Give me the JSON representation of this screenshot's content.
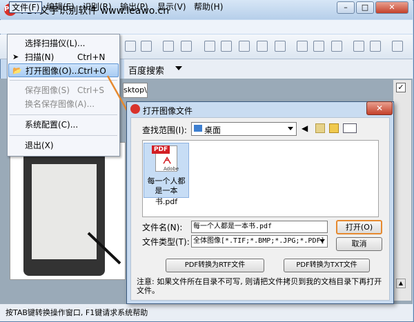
{
  "app": {
    "title": "PDF文字识别软件 www.leawo.cn",
    "icon_text": "PDF"
  },
  "window_controls": {
    "minimize": "–",
    "maximize": "□",
    "close": "✕"
  },
  "menubar": [
    "文件(F)",
    "编辑(E)",
    "识别(R)",
    "输出(P)",
    "显示(V)",
    "帮助(H)"
  ],
  "file_menu": {
    "items": [
      {
        "label": "选择扫描仪(L)...",
        "shortcut": "",
        "disabled": false
      },
      {
        "label": "扫描(N)",
        "shortcut": "Ctrl+N",
        "disabled": false
      },
      {
        "label": "打开图像(O)...",
        "shortcut": "Ctrl+O",
        "disabled": false,
        "highlighted": true
      },
      {
        "label": "保存图像(S)",
        "shortcut": "Ctrl+S",
        "disabled": true
      },
      {
        "label": "换名保存图像(A)...",
        "shortcut": "",
        "disabled": true
      },
      {
        "label": "系统配置(C)...",
        "shortcut": "",
        "disabled": false
      },
      {
        "label": "退出(X)",
        "shortcut": "",
        "disabled": false
      }
    ]
  },
  "search": {
    "label": "百度搜索"
  },
  "desktop_strip": "sktop\\",
  "dialog": {
    "title": "打开图像文件",
    "lookin_label": "查找范围(I):",
    "lookin_value": "桌面",
    "file": {
      "line1": "每一个人都",
      "line2": "是一本书.pdf",
      "badge": "PDF",
      "brand": "Adobe"
    },
    "filename_label": "文件名(N):",
    "filename_value": "每一个人都是一本书.pdf",
    "filetype_label": "文件类型(T):",
    "filetype_value": "全体图像[*.TIF;*.BMP;*.JPG;*.PDF]",
    "open_button": "打开(O)",
    "cancel_button": "取消",
    "rtf_button": "PDF转换为RTF文件",
    "txt_button": "PDF转换为TXT文件",
    "note": "注意: 如果文件所在目录不可写, 则请把文件拷贝到我的文档目录下再打开文件。",
    "close": "✕"
  },
  "statusbar": {
    "text": "按TAB键转换操作窗口, F1键请求系统帮助"
  },
  "colors": {
    "accent_orange": "#e6892f",
    "titlebar": "#c6daf0",
    "pdf_red": "#d21e24"
  }
}
